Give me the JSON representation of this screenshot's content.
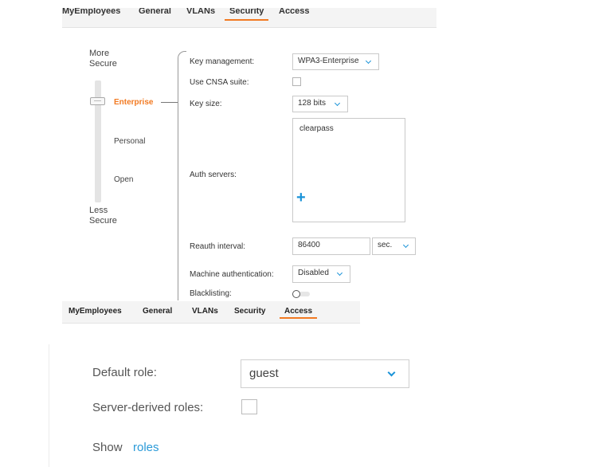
{
  "top_tabs": [
    {
      "label": "MyEmployees",
      "active": false
    },
    {
      "label": "General",
      "active": false
    },
    {
      "label": "VLANs",
      "active": false
    },
    {
      "label": "Security",
      "active": true
    },
    {
      "label": "Access",
      "active": false
    }
  ],
  "security": {
    "more_secure": "More\nSecure",
    "less_secure": "Less\nSecure",
    "levels": [
      {
        "label": "Enterprise",
        "active": true
      },
      {
        "label": "Personal",
        "active": false
      },
      {
        "label": "Open",
        "active": false
      }
    ],
    "fields": {
      "key_management": {
        "label": "Key management:",
        "value": "WPA3-Enterprise"
      },
      "cnsa": {
        "label": "Use CNSA suite:",
        "checked": false
      },
      "key_size": {
        "label": "Key size:",
        "value": "128 bits"
      },
      "auth_servers": {
        "label": "Auth servers:",
        "items": [
          "clearpass"
        ]
      },
      "reauth_interval": {
        "label": "Reauth interval:",
        "value": "86400",
        "unit": "sec."
      },
      "machine_auth": {
        "label": "Machine authentication:",
        "value": "Disabled"
      },
      "blacklisting": {
        "label": "Blacklisting:",
        "enabled": false
      }
    }
  },
  "mid_tabs": [
    {
      "label": "MyEmployees",
      "active": false
    },
    {
      "label": "General",
      "active": false
    },
    {
      "label": "VLANs",
      "active": false
    },
    {
      "label": "Security",
      "active": false
    },
    {
      "label": "Access",
      "active": true
    }
  ],
  "access": {
    "default_role": {
      "label": "Default role:",
      "value": "guest"
    },
    "server_derived_roles": {
      "label": "Server-derived roles:",
      "checked": false
    },
    "show_label": "Show",
    "roles_link": "roles"
  },
  "colors": {
    "accent": "#f27a22",
    "link": "#1a93d8"
  }
}
